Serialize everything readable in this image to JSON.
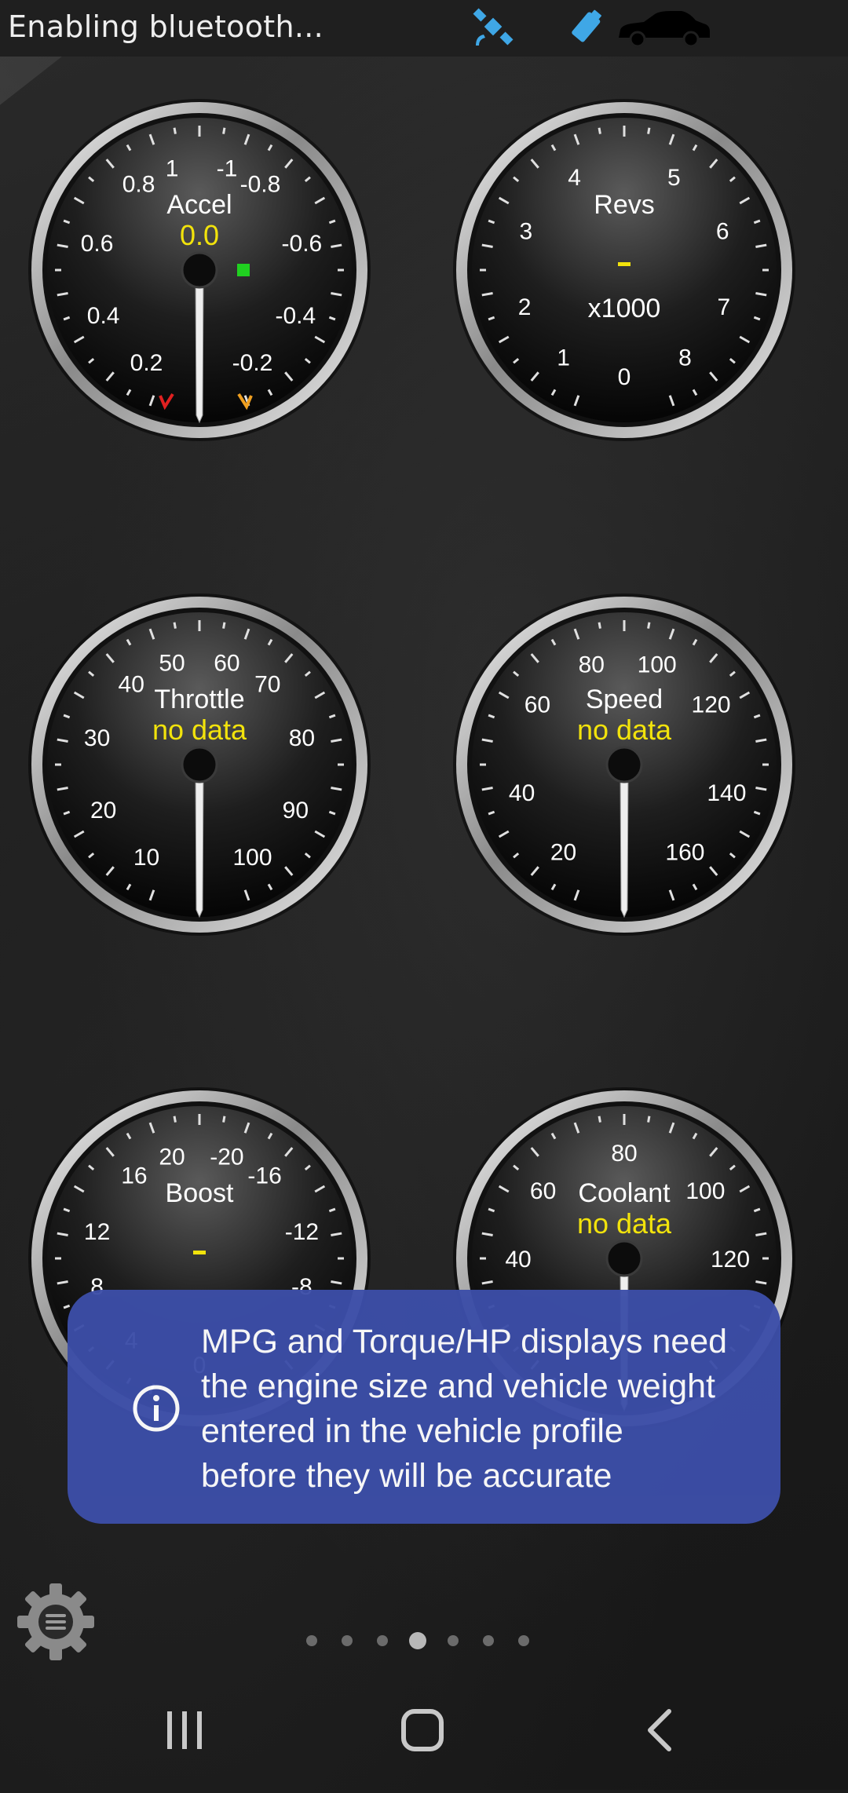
{
  "status_bar": {
    "text": "Enabling bluetooth...",
    "icons": [
      "gps-satellite-icon",
      "bluetooth-adapter-icon",
      "car-icon"
    ]
  },
  "gauges": [
    {
      "id": "accel",
      "name": "Accel",
      "value": "0.0",
      "ticks": [
        "1",
        "0.8",
        "0.6",
        "0.4",
        "0.2",
        "-1",
        "-0.8",
        "-0.6",
        "-0.4",
        "-0.2"
      ]
    },
    {
      "id": "revs",
      "name": "Revs",
      "value": "-",
      "unit": "x1000",
      "ticks": [
        "0",
        "1",
        "2",
        "3",
        "4",
        "5",
        "6",
        "7",
        "8"
      ]
    },
    {
      "id": "throttle",
      "name": "Throttle",
      "value": "no data",
      "ticks": [
        "10",
        "20",
        "30",
        "40",
        "50",
        "60",
        "70",
        "80",
        "90",
        "100"
      ]
    },
    {
      "id": "speed",
      "name": "Speed",
      "value": "no data",
      "ticks": [
        "20",
        "40",
        "60",
        "80",
        "100",
        "120",
        "140",
        "160"
      ]
    },
    {
      "id": "boost",
      "name": "Boost",
      "value": "-",
      "ticks": [
        "20",
        "16",
        "12",
        "8",
        "4",
        "0",
        "-20",
        "-16",
        "-12",
        "-8",
        "-4"
      ]
    },
    {
      "id": "coolant",
      "name": "Coolant",
      "value": "no data",
      "ticks": [
        "40",
        "60",
        "80",
        "100",
        "120"
      ]
    }
  ],
  "toast": {
    "lines": [
      "MPG and Torque/HP displays need",
      "the engine size and vehicle weight",
      "entered in the vehicle profile",
      "before they will be accurate"
    ],
    "icon": "info-icon"
  },
  "pager": {
    "count": 7,
    "active_index": 3
  },
  "colors": {
    "accent_yellow": "#f2e30c",
    "toast_bg": "#3c4ea8"
  }
}
